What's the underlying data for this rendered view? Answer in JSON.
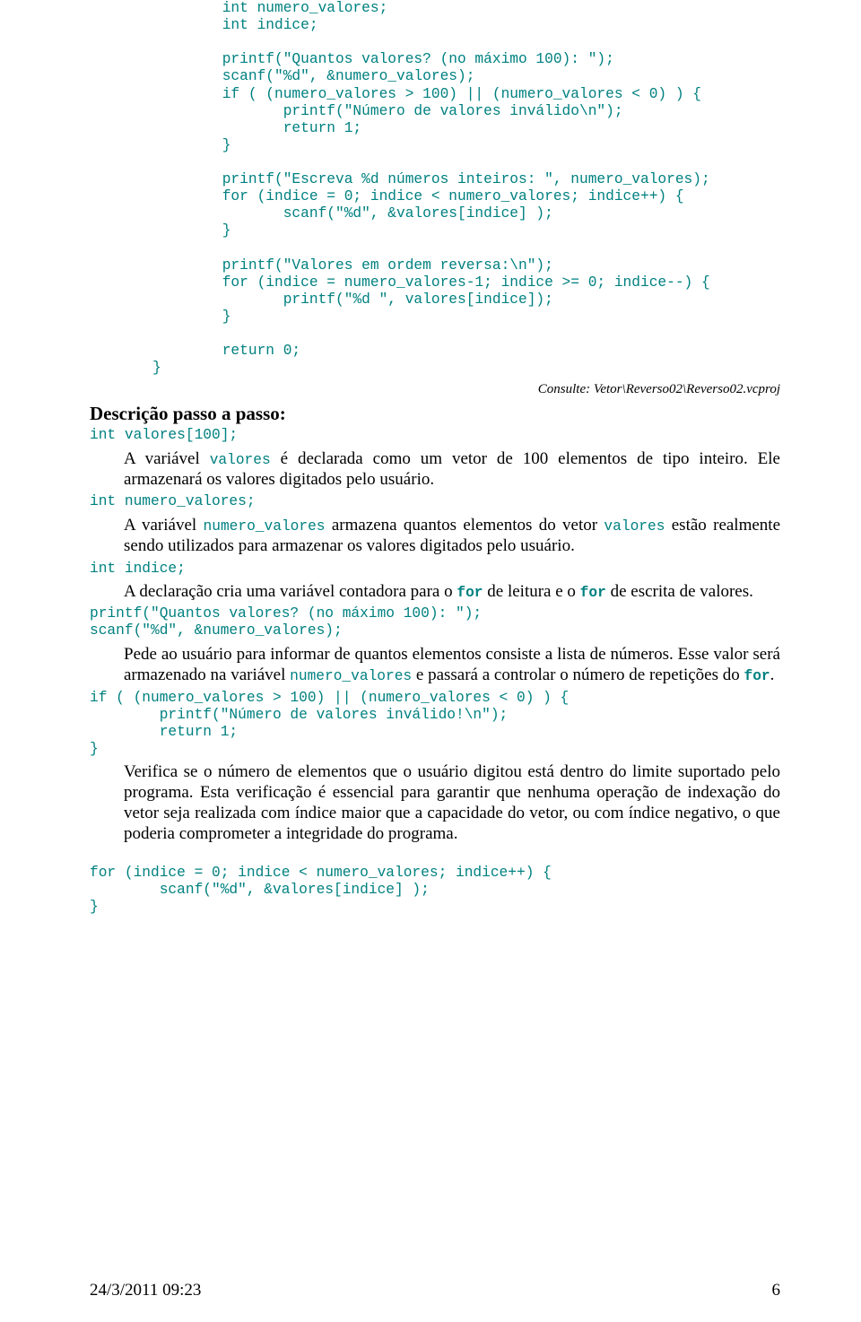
{
  "code_top": "        int numero_valores;\n        int indice;\n\n        printf(\"Quantos valores? (no máximo 100): \");\n        scanf(\"%d\", &numero_valores);\n        if ( (numero_valores > 100) || (numero_valores < 0) ) {\n               printf(\"Número de valores inválido\\n\");\n               return 1;\n        }\n\n        printf(\"Escreva %d números inteiros: \", numero_valores);\n        for (indice = 0; indice < numero_valores; indice++) {\n               scanf(\"%d\", &valores[indice] );\n        }\n\n        printf(\"Valores em ordem reversa:\\n\");\n        for (indice = numero_valores-1; indice >= 0; indice--) {\n               printf(\"%d \", valores[indice]);\n        }\n\n        return 0;\n}",
  "consult": "Consulte: Vetor\\Reverso02\\Reverso02.vcproj",
  "heading": "Descrição passo a passo:",
  "c1": "int valores[100];",
  "p1a": "A variável ",
  "p1b": "valores",
  "p1c": " é declarada como um vetor de 100 elementos de tipo inteiro. Ele armazenará os valores digitados pelo usuário.",
  "c2": "int numero_valores;",
  "p2a": "A variável ",
  "p2b": "numero_valores",
  "p2c": " armazena quantos elementos do vetor ",
  "p2d": "valores",
  "p2e": " estão realmente sendo utilizados para armazenar os valores digitados pelo usuário.",
  "c3": "int indice;",
  "p3a": "A declaração cria uma variável contadora para o ",
  "p3b": "for",
  "p3c": " de leitura e o ",
  "p3d": "for",
  "p3e": " de escrita de valores.",
  "c4": "printf(\"Quantos valores? (no máximo 100): \");\nscanf(\"%d\", &numero_valores);",
  "p4a": "Pede ao usuário para informar de quantos elementos consiste a lista de números. Esse valor será armazenado na variável ",
  "p4b": "numero_valores",
  "p4c": " e passará a controlar o número de repetições do ",
  "p4d": "for",
  "p4e": ".",
  "c5": "if ( (numero_valores > 100) || (numero_valores < 0) ) {\n        printf(\"Número de valores inválido!\\n\");\n        return 1;\n}",
  "p5": "Verifica se o número de elementos que o usuário digitou está dentro do limite suportado pelo programa. Esta verificação é essencial para garantir que nenhuma operação de indexação do vetor seja realizada com índice maior que a capacidade do vetor, ou com índice negativo, o que poderia comprometer a integridade do programa.",
  "c6": "for (indice = 0; indice < numero_valores; indice++) {\n        scanf(\"%d\", &valores[indice] );\n}",
  "footer_left": "24/3/2011 09:23",
  "footer_right": "6"
}
